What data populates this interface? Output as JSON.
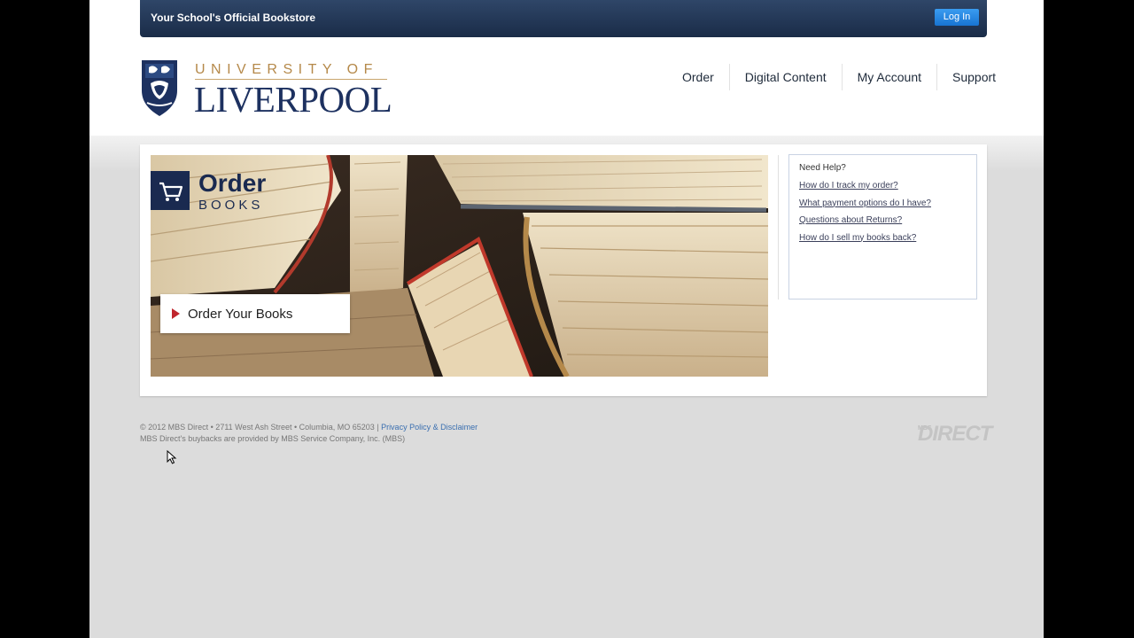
{
  "topbar": {
    "title": "Your School's Official Bookstore",
    "login_label": "Log In"
  },
  "logo": {
    "line1": "UNIVERSITY OF",
    "line2": "LIVERPOOL"
  },
  "nav": {
    "items": [
      {
        "label": "Order"
      },
      {
        "label": "Digital Content"
      },
      {
        "label": "My Account"
      },
      {
        "label": "Support"
      }
    ]
  },
  "hero": {
    "title": "Order",
    "subtitle": "BOOKS",
    "button_label": "Order Your Books"
  },
  "help": {
    "title": "Need Help?",
    "links": [
      {
        "label": "How do I track my order?"
      },
      {
        "label": "What payment options do I have?"
      },
      {
        "label": "Questions about Returns?"
      },
      {
        "label": "How do I sell my books back?"
      }
    ]
  },
  "footer": {
    "copyright": "© 2012 MBS Direct • 2711 West Ash Street • Columbia, MO 65203 | ",
    "privacy_link": "Privacy Policy & Disclaimer",
    "line2": "MBS Direct's buybacks are provided by MBS Service Company, Inc. (MBS)",
    "brand_small": "MBS",
    "brand": "DIRECT"
  },
  "colors": {
    "navy": "#1a2a50",
    "login_blue": "#1874d2",
    "logo_gold": "#b5894a",
    "accent_red": "#c0262d"
  }
}
